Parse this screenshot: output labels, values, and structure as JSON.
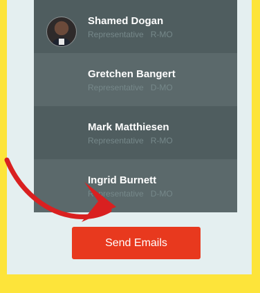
{
  "representatives": [
    {
      "name": "Shamed Dogan",
      "role": "Representative",
      "party": "R-MO",
      "has_avatar": true
    },
    {
      "name": "Gretchen Bangert",
      "role": "Representative",
      "party": "D-MO",
      "has_avatar": false
    },
    {
      "name": "Mark Matthiesen",
      "role": "Representative",
      "party": "R-MO",
      "has_avatar": false
    },
    {
      "name": "Ingrid Burnett",
      "role": "Representative",
      "party": "D-MO",
      "has_avatar": false
    }
  ],
  "send_button": {
    "label": "Send Emails"
  },
  "colors": {
    "background": "#fde43a",
    "panel": "#e4eff0",
    "row_dark": "#4f5d5f",
    "row_light": "#5b696b",
    "button": "#e8391e",
    "arrow": "#d92020"
  },
  "annotation": {
    "icon": "red-arrow-icon"
  }
}
